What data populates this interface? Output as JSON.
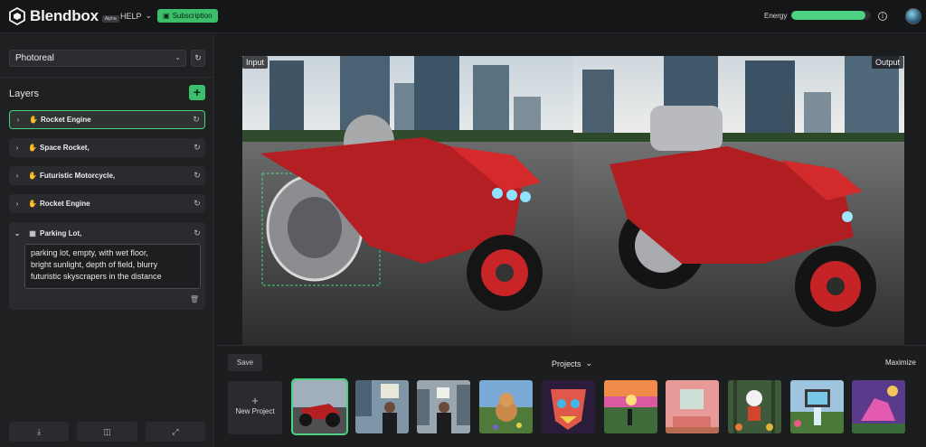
{
  "app": {
    "name": "Blendbox",
    "badge": "Alpha",
    "help_label": "HELP",
    "subscription_label": "Subscription",
    "energy_label": "Energy",
    "energy_level": 0.93
  },
  "sidebar": {
    "style_value": "Photoreal",
    "layers_title": "Layers",
    "layers": [
      {
        "name": "Rocket Engine",
        "icon": "hand-icon",
        "active": true
      },
      {
        "name": "Space Rocket,",
        "icon": "hand-icon",
        "active": false
      },
      {
        "name": "Futuristic Motorcycle,",
        "icon": "hand-icon",
        "active": false
      },
      {
        "name": "Rocket Engine",
        "icon": "hand-icon",
        "active": false
      }
    ],
    "expanded_layer": {
      "name": "Parking Lot,",
      "icon": "image-icon",
      "prompt": "parking lot, empty, with wet floor,\nbright sunlight, depth of field, blurry\nfuturistic skyscrapers in the distance"
    }
  },
  "canvas": {
    "input_label": "Input",
    "output_label": "Output"
  },
  "bottom": {
    "save_label": "Save",
    "projects_label": "Projects",
    "maximize_label": "Maximize",
    "new_project_label": "New Project",
    "thumbnails": [
      {
        "name": "red-motorcycle-thumb",
        "selected": true
      },
      {
        "name": "protest-sign-thumb",
        "selected": false
      },
      {
        "name": "person-city-thumb",
        "selected": false
      },
      {
        "name": "dog-field-thumb",
        "selected": false
      },
      {
        "name": "colorful-mask-thumb",
        "selected": false
      },
      {
        "name": "sunset-landscape-thumb",
        "selected": false
      },
      {
        "name": "pink-room-thumb",
        "selected": false
      },
      {
        "name": "panda-forest-thumb",
        "selected": false
      },
      {
        "name": "tv-waterfall-thumb",
        "selected": false
      },
      {
        "name": "pink-creature-thumb",
        "selected": false
      }
    ]
  },
  "colors": {
    "accent": "#4cd282",
    "accent_dark": "#3bbf6a"
  }
}
